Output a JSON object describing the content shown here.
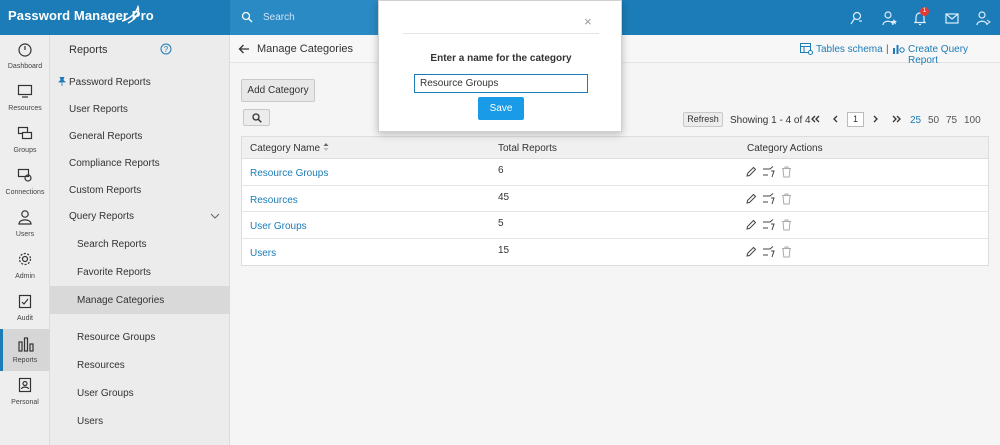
{
  "app": {
    "name": "Password Manager Pro"
  },
  "topbar": {
    "search_placeholder": "Search",
    "notification_count": "1"
  },
  "rail": [
    {
      "label": "Dashboard",
      "icon": "dashboard-icon"
    },
    {
      "label": "Resources",
      "icon": "monitor-icon"
    },
    {
      "label": "Groups",
      "icon": "groups-icon"
    },
    {
      "label": "Connections",
      "icon": "connections-icon"
    },
    {
      "label": "Users",
      "icon": "user-icon"
    },
    {
      "label": "Admin",
      "icon": "gear-icon"
    },
    {
      "label": "Audit",
      "icon": "clipboard-check-icon"
    },
    {
      "label": "Reports",
      "icon": "bar-chart-icon"
    },
    {
      "label": "Personal",
      "icon": "contact-card-icon"
    }
  ],
  "subnav": {
    "title": "Reports",
    "items": [
      {
        "label": "Password Reports"
      },
      {
        "label": "User Reports"
      },
      {
        "label": "General Reports"
      },
      {
        "label": "Compliance Reports"
      },
      {
        "label": "Custom Reports"
      },
      {
        "label": "Query Reports"
      },
      {
        "label": "Search Reports"
      },
      {
        "label": "Favorite Reports"
      },
      {
        "label": "Manage Categories"
      },
      {
        "label": "Resource Groups"
      },
      {
        "label": "Resources"
      },
      {
        "label": "User Groups"
      },
      {
        "label": "Users"
      }
    ]
  },
  "main": {
    "title": "Manage Categories",
    "tables_schema": "Tables schema",
    "separator": "|",
    "create_query_report": "Create Query Report",
    "add_category": "Add Category",
    "refresh": "Refresh",
    "showing": "Showing 1 - 4 of 4",
    "page": "1",
    "page_sizes": [
      "25",
      "50",
      "75",
      "100"
    ],
    "columns": [
      "Category Name",
      "Total Reports",
      "Category Actions"
    ],
    "rows": [
      {
        "name": "Resource Groups",
        "total": "6"
      },
      {
        "name": "Resources",
        "total": "45"
      },
      {
        "name": "User Groups",
        "total": "5"
      },
      {
        "name": "Users",
        "total": "15"
      }
    ]
  },
  "modal": {
    "close": "×",
    "title": "Enter a name for the category",
    "input_value": "Resource Groups",
    "save": "Save"
  },
  "colors": {
    "brand": "#1b7cb8",
    "save_button": "#1a9be8",
    "badge": "#e53935"
  }
}
